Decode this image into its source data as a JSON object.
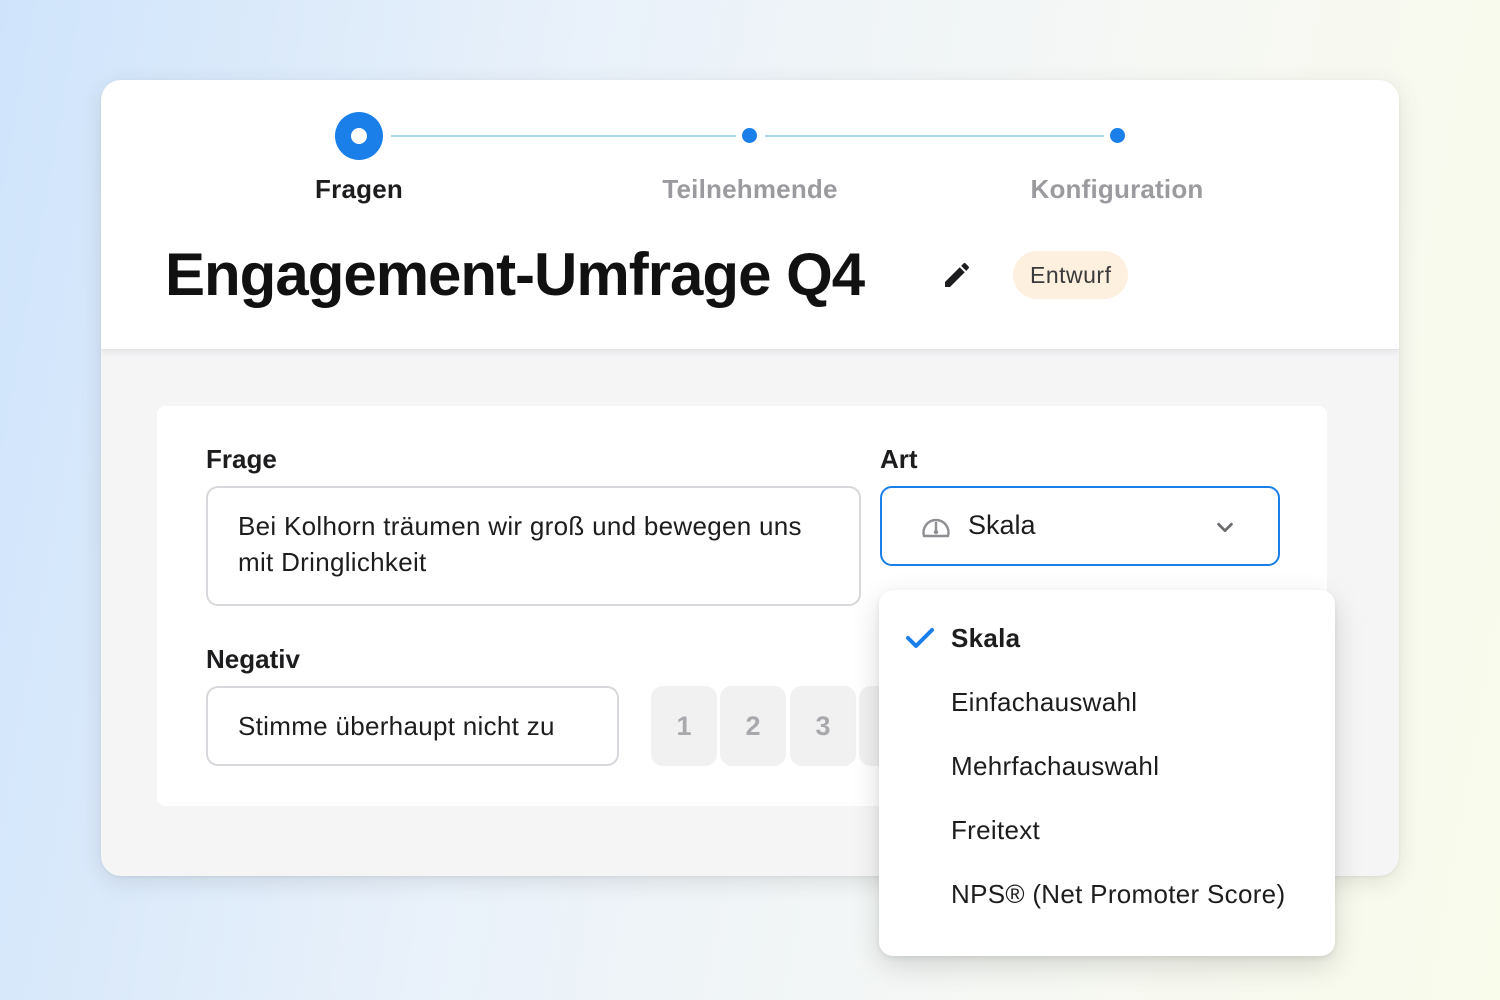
{
  "stepper": {
    "steps": [
      {
        "label": "Fragen",
        "state": "active"
      },
      {
        "label": "Teilnehmende",
        "state": "inactive"
      },
      {
        "label": "Konfiguration",
        "state": "inactive"
      }
    ]
  },
  "survey": {
    "title": "Engagement-Umfrage Q4",
    "status_badge": "Entwurf"
  },
  "question": {
    "label": "Frage",
    "text": "Bei Kolhorn träumen wir groß und bewegen uns mit Dringlichkeit"
  },
  "type": {
    "label": "Art",
    "selected": "Skala",
    "icon": "gauge-icon"
  },
  "negative": {
    "label": "Negativ",
    "value": "Stimme überhaupt nicht zu"
  },
  "scale": {
    "buttons": [
      "1",
      "2",
      "3"
    ]
  },
  "dropdown": {
    "options": [
      {
        "label": "Skala",
        "selected": true
      },
      {
        "label": "Einfachauswahl",
        "selected": false
      },
      {
        "label": "Mehrfachauswahl",
        "selected": false
      },
      {
        "label": "Freitext",
        "selected": false
      },
      {
        "label": "NPS® (Net Promoter Score)",
        "selected": false
      }
    ]
  },
  "colors": {
    "accent": "#1a7fe8",
    "badge_bg": "#fdf0de",
    "step_line": "#a8d4ee"
  }
}
